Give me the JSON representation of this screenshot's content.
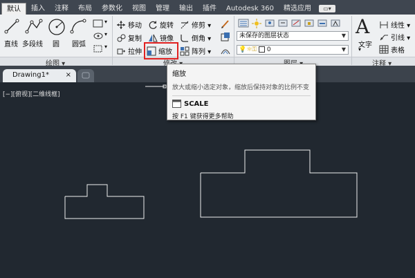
{
  "menu": {
    "tabs": [
      "默认",
      "插入",
      "注释",
      "布局",
      "参数化",
      "视图",
      "管理",
      "输出",
      "插件",
      "Autodesk 360",
      "精选应用"
    ],
    "active_index": 0,
    "pill_glyph": "▭▾"
  },
  "draw": {
    "line": "直线",
    "polyline": "多段线",
    "circle": "圆",
    "arc": "圆弧",
    "panel_title": "绘图 ▾"
  },
  "modify": {
    "move": "移动",
    "rotate": "旋转",
    "trim": "修剪 ▾",
    "copy": "复制",
    "mirror": "镜像",
    "fillet": "倒角 ▾",
    "stretch": "拉伸",
    "scale": "缩放",
    "array": "阵列 ▾",
    "panel_title": "修改 ▾"
  },
  "layers": {
    "state": "未保存的图层状态",
    "current_layer": "0",
    "panel_title": "图层 ▾"
  },
  "annotation": {
    "text": "文字",
    "linear": "线性 ▾",
    "leader": "引线 ▾",
    "table": "表格",
    "panel_title": "注释 ▾"
  },
  "doc_tab": {
    "name": "Drawing1*",
    "close": "×"
  },
  "viewport_label": "[−][俯视][二维线框]",
  "tooltip": {
    "title": "缩放",
    "description": "放大或缩小选定对象，缩放后保持对象的比例不变",
    "command": "SCALE",
    "help": "按 F1 键获得更多帮助"
  },
  "colors": {
    "canvas": "#212830",
    "highlight": "#e02020",
    "ribbon": "#eef0f2"
  }
}
